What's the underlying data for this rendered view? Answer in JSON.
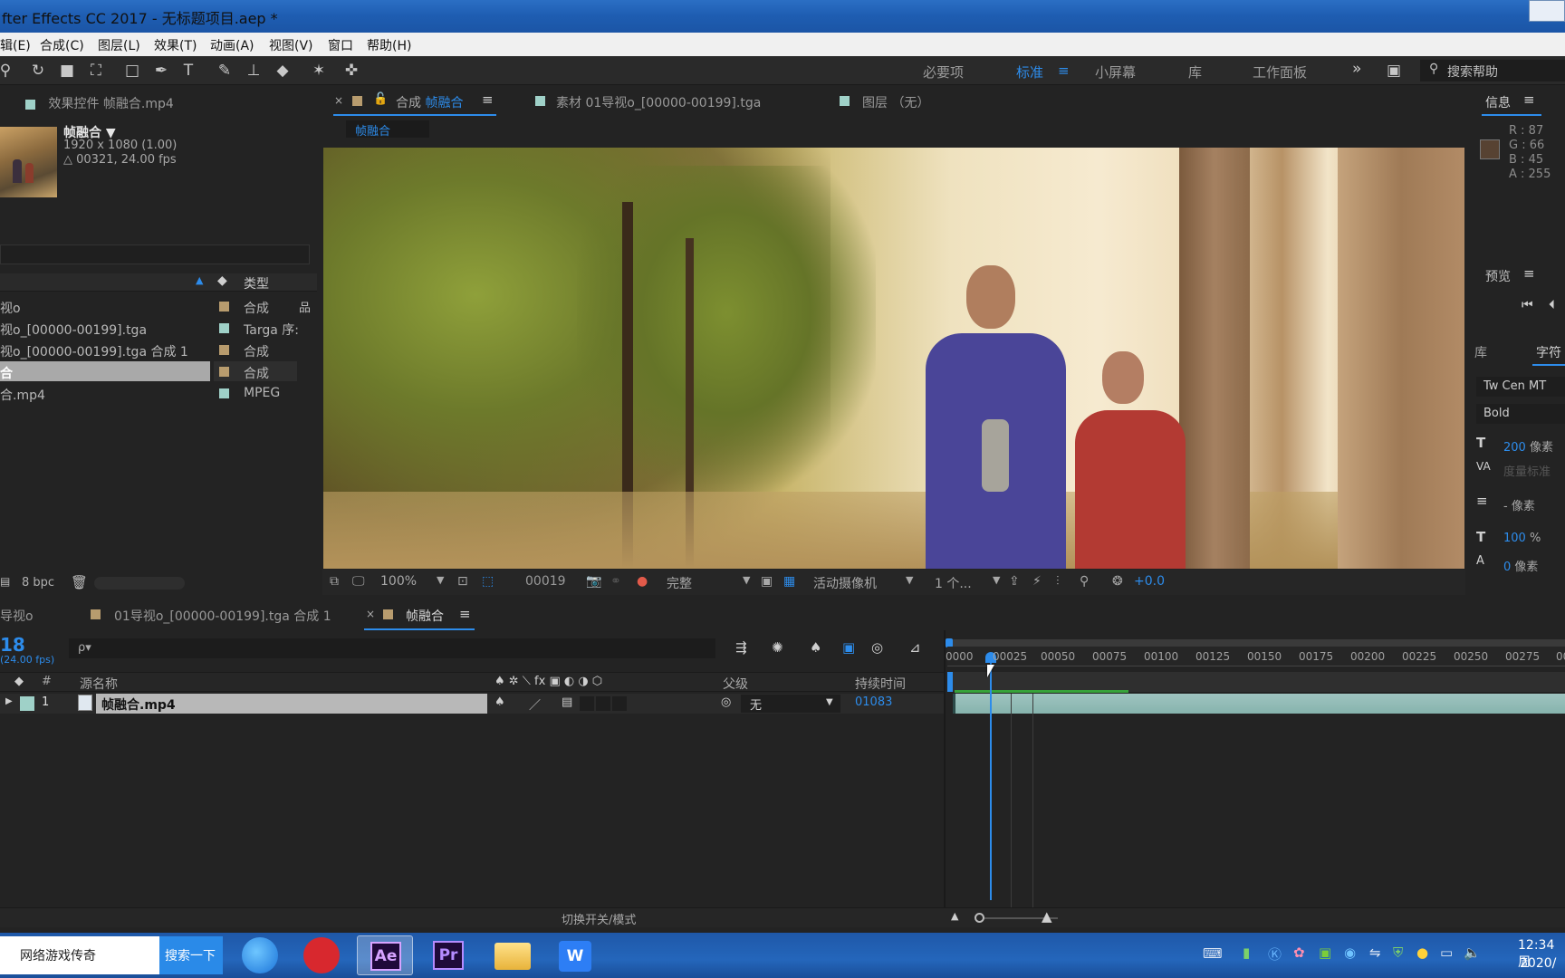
{
  "window": {
    "title": "fter Effects CC 2017 - 无标题项目.aep *"
  },
  "menu": [
    "辑(E)",
    "合成(C)",
    "图层(L)",
    "效果(T)",
    "动画(A)",
    "视图(V)",
    "窗口",
    "帮助(H)"
  ],
  "workspaces": {
    "items": [
      "必要项",
      "标准",
      "小屏幕",
      "库",
      "工作面板"
    ],
    "active": "标准",
    "more": "»",
    "help_placeholder": "搜索帮助"
  },
  "effects_panel": {
    "tab": "效果控件 帧融合.mp4",
    "name": "帧融合 ▼",
    "resolution": "1920 x 1080 (1.00)",
    "duration": "△ 00321, 24.00 fps"
  },
  "project": {
    "col_type": "类型",
    "items": [
      {
        "name": "视o",
        "type": "合成",
        "color": "#b89c6e",
        "selected": false,
        "icon": "flowchart-icon"
      },
      {
        "name": "视o_[00000-00199].tga",
        "type": "Targa 序:",
        "color": "#9fd1c8",
        "selected": false
      },
      {
        "name": "视o_[00000-00199].tga 合成 1",
        "type": "合成",
        "color": "#b89c6e",
        "selected": false
      },
      {
        "name": "合",
        "type": "合成",
        "color": "#b89c6e",
        "selected": true
      },
      {
        "name": "合.mp4",
        "type": "MPEG",
        "color": "#9fd1c8",
        "selected": false
      }
    ],
    "bpc": "8 bpc"
  },
  "viewer": {
    "tabs": [
      {
        "label": "合成 ",
        "accent": "帧融合",
        "active": true
      },
      {
        "label": "素材 01导视o_[00000-00199].tga",
        "accent": "",
        "active": false
      },
      {
        "label": "图层 （无）",
        "accent": "",
        "active": false
      }
    ],
    "comp_chip": "帧融合",
    "zoom": "100%",
    "frame": "00019",
    "quality": "完整",
    "camera": "活动摄像机",
    "views": "1 个...",
    "exposure": "+0.0"
  },
  "info": {
    "tab": "信息",
    "r": "R : 87",
    "g": "G : 66",
    "b": "B : 45",
    "a": "A : 255",
    "swatch": "#574232"
  },
  "preview": {
    "tab": "预览"
  },
  "character": {
    "tab_lib": "库",
    "tab_char": "字符",
    "font": "Tw Cen MT",
    "style": "Bold",
    "size": "200",
    "size_unit": " 像素",
    "tracking": "度量标准",
    "leading": "- 像素",
    "vscale": "100",
    "vscale_unit": " %",
    "baseline": "0",
    "baseline_unit": " 像素"
  },
  "timeline": {
    "tabs": [
      {
        "label": "导视o",
        "active": false
      },
      {
        "label": "01导视o_[00000-00199].tga 合成 1",
        "active": false
      },
      {
        "label": "帧融合",
        "active": true
      }
    ],
    "current_frame": "18",
    "fps": "(24.00 fps)",
    "search_placeholder": "ρ▾",
    "ruler": [
      "0000",
      "00025",
      "00050",
      "00075",
      "00100",
      "00125",
      "00150",
      "00175",
      "00200",
      "00225",
      "00250",
      "00275",
      "00"
    ],
    "col_num": "#",
    "col_source": "源名称",
    "col_parent": "父级",
    "col_duration": "持续时间",
    "layers": [
      {
        "index": "1",
        "name": "帧融合.mp4",
        "parent": "无",
        "duration": "01083"
      }
    ],
    "toggle_label": "切换开关/模式"
  },
  "taskbar": {
    "search_text": "网络游戏传奇",
    "search_button": "搜索一下",
    "clock_time": "12:34 周",
    "clock_date": "2020/"
  }
}
